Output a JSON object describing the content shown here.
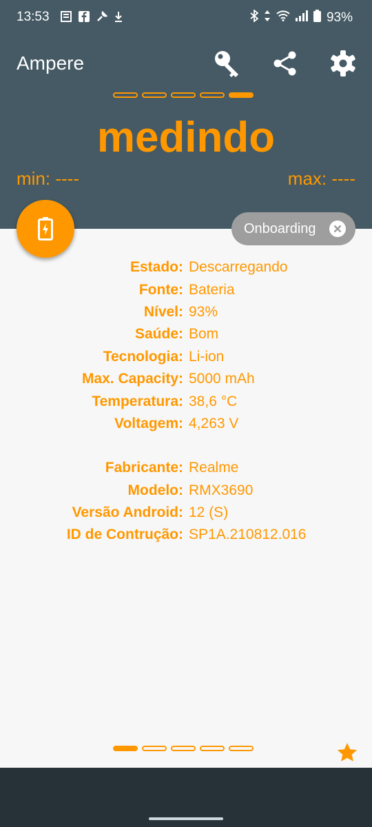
{
  "status": {
    "time": "13:53",
    "battery_percent": "93%",
    "left_icons": [
      "news-icon",
      "facebook-icon",
      "wrench-icon",
      "download-icon"
    ],
    "right_icons": [
      "bluetooth-icon",
      "data-arrows-icon",
      "wifi-icon",
      "signal-icon",
      "battery-icon"
    ]
  },
  "app_bar": {
    "title": "Ampere",
    "actions": [
      "key-icon",
      "share-icon",
      "settings-icon"
    ]
  },
  "measure": {
    "state": "medindo",
    "min_label": "min: ----",
    "max_label": "max: ----",
    "top_dots_active_index": 4,
    "dots_count": 5
  },
  "chip": {
    "label": "Onboarding"
  },
  "battery_info": [
    {
      "key": "Estado:",
      "value": "Descarregando"
    },
    {
      "key": "Fonte:",
      "value": "Bateria"
    },
    {
      "key": "Nível:",
      "value": "93%"
    },
    {
      "key": "Saúde:",
      "value": "Bom"
    },
    {
      "key": "Tecnologia:",
      "value": "Li-ion"
    },
    {
      "key": "Max. Capacity:",
      "value": "5000 mAh"
    },
    {
      "key": "Temperatura:",
      "value": "38,6 °C"
    },
    {
      "key": "Voltagem:",
      "value": "4,263 V"
    }
  ],
  "device_info": [
    {
      "key": "Fabricante:",
      "value": "Realme"
    },
    {
      "key": "Modelo:",
      "value": "RMX3690"
    },
    {
      "key": "Versão Android:",
      "value": "12 (S)"
    },
    {
      "key": "ID de Contrução:",
      "value": "SP1A.210812.016"
    }
  ],
  "pager": {
    "active_index": 0,
    "count": 5
  },
  "colors": {
    "accent": "#ff9800",
    "app_bar": "#455a64",
    "nav_bar": "#263238",
    "chip": "#9e9e9e"
  }
}
